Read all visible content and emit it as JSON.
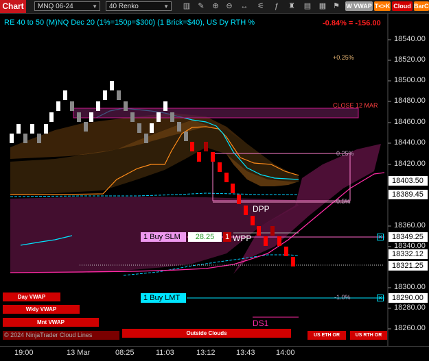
{
  "toolbar": {
    "chart_button": "Chart",
    "instrument": "MNQ 06-24",
    "bar_type": "40 Renko",
    "icons": [
      "bar-style-icon",
      "drawing-tool-icon",
      "zoom-in-icon",
      "zoom-out-icon",
      "scroll-icon",
      "properties-icon",
      "indicators-icon",
      "strategies-icon",
      "data-box-icon",
      "templates-icon",
      "chart-trader-icon",
      "alerts-icon"
    ],
    "pills": {
      "vwap": "W VWAP",
      "tk": "T<>K",
      "cloud": "Cloud",
      "barco": "BarCo"
    }
  },
  "header": {
    "title": "RE 40 to 50 (M)NQ Dec 20 (1%=150p=$300) (1 Brick=$40), US Dy RTH %",
    "pnl": "-0.84% = -156.00"
  },
  "price_axis": {
    "ticks": [
      "18540.00",
      "18520.00",
      "18500.00",
      "18480.00",
      "18460.00",
      "18440.00",
      "18420.00",
      "18360.00",
      "18340.00",
      "18300.00",
      "18280.00",
      "18260.00"
    ],
    "tags": [
      {
        "label": "18403.50",
        "bg": "#ffffff",
        "fg": "#000000"
      },
      {
        "label": "18389.45",
        "bg": "#ffffff",
        "fg": "#000000"
      },
      {
        "label": "18349.25",
        "bg": "#ffffff",
        "fg": "#000000"
      },
      {
        "label": "18332.12",
        "bg": "#ffffff",
        "fg": "#000000"
      },
      {
        "label": "18321.25",
        "bg": "#ffffff",
        "fg": "#000000"
      },
      {
        "label": "18290.00",
        "bg": "#ffffff",
        "fg": "#000000"
      }
    ]
  },
  "time_axis": [
    "19:00",
    "13 Mar",
    "08:25",
    "11:03",
    "13:12",
    "13:43",
    "14:00"
  ],
  "levels": {
    "p025_top": "+0.25%",
    "close_label": "CLOSE 12 MAR",
    "p025_mid": "0.25%",
    "p05": "0.5%",
    "m10": "-1.0%",
    "dpp": "DPP",
    "wpp": "WPP",
    "ds1": "DS1"
  },
  "orders": {
    "buy_slm_label": "1 Buy SLM",
    "buy_slm_price": "28.25",
    "buy_slm_qty": "1",
    "buy_lmt_label": "1 Buy LMT"
  },
  "bottom_buttons": {
    "day_vwap": "Day VWAP",
    "wkly_vwap": "Wkly VWAP",
    "mnt_vwap": "Mnt VWAP",
    "copyright": "© 2024 NinjaTrader Cloud Lines",
    "outside_clouds": "Outside Clouds",
    "us_eth": "US ETH OR",
    "us_rth": "US RTH OR"
  },
  "colors": {
    "accent_cyan": "#00e5ff",
    "up_brick": "#ffffff",
    "down_brick": "#ff0000",
    "cloud_orange": "#ff8c1a",
    "cloud_purple": "#c8198c"
  }
}
